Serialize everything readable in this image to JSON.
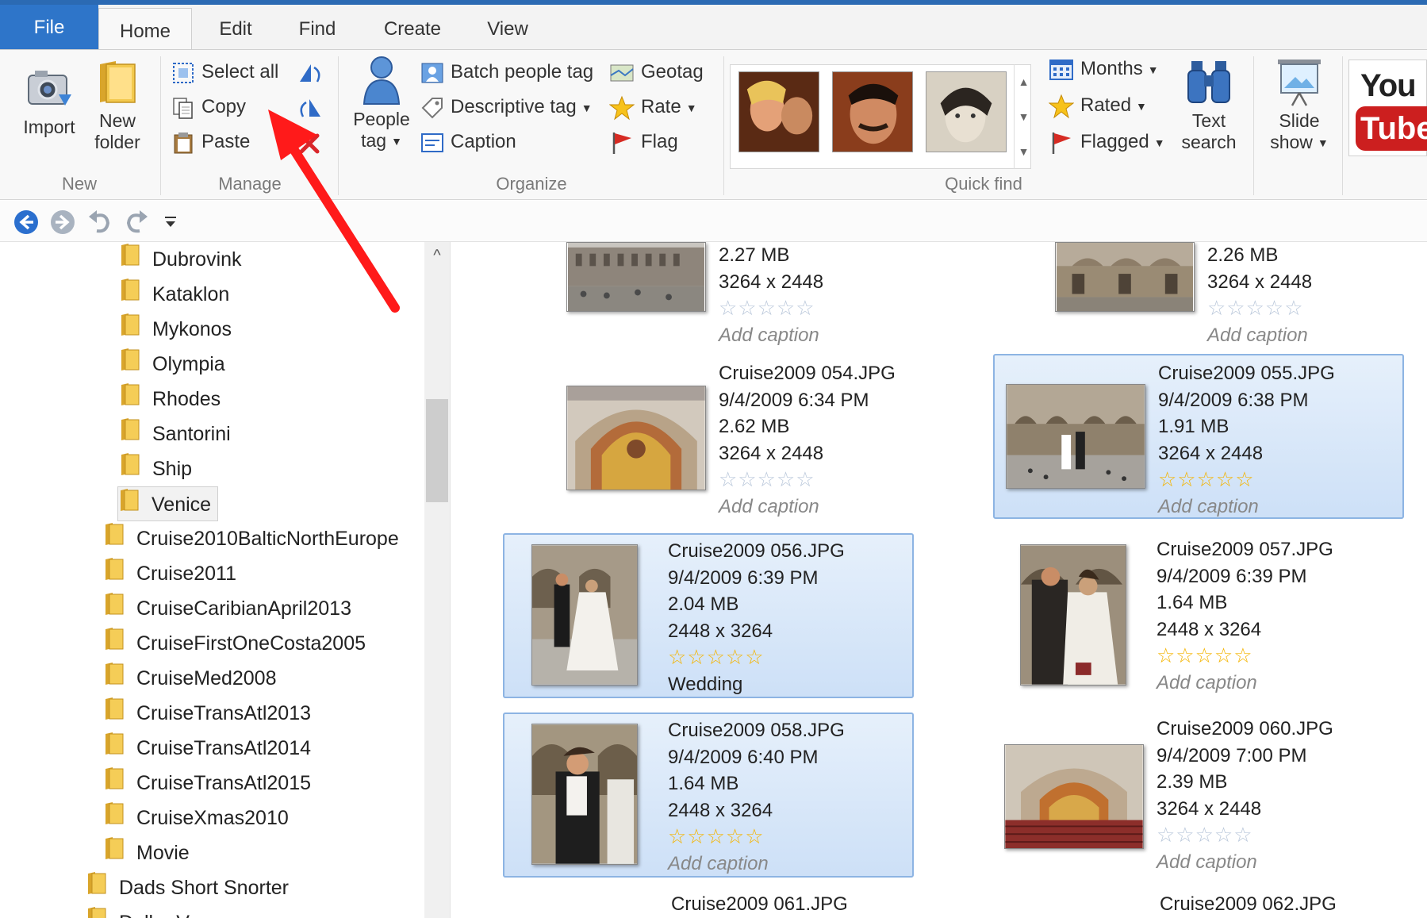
{
  "tabs": {
    "file": "File",
    "home": "Home",
    "edit": "Edit",
    "find": "Find",
    "create": "Create",
    "view": "View"
  },
  "ribbon": {
    "new_group": {
      "label": "New",
      "import": "Import",
      "new_folder_line1": "New",
      "new_folder_line2": "folder"
    },
    "manage_group": {
      "label": "Manage",
      "select_all": "Select all",
      "copy": "Copy",
      "paste": "Paste"
    },
    "organize_group": {
      "label": "Organize",
      "people_tag_line1": "People",
      "people_tag_line2": "tag",
      "batch_people_tag": "Batch people tag",
      "descriptive_tag": "Descriptive tag",
      "caption": "Caption",
      "geotag": "Geotag",
      "rate": "Rate",
      "flag": "Flag"
    },
    "quick_find_group": {
      "label": "Quick find",
      "months": "Months",
      "rated": "Rated",
      "flagged": "Flagged",
      "text_search_line1": "Text",
      "text_search_line2": "search",
      "slide_show_line1": "Slide",
      "slide_show_line2": "show"
    },
    "youtube": {
      "line1": "You",
      "line2": "Tube"
    }
  },
  "tree": {
    "items": [
      {
        "label": "Dubrovink"
      },
      {
        "label": "Kataklon"
      },
      {
        "label": "Mykonos"
      },
      {
        "label": "Olympia"
      },
      {
        "label": "Rhodes"
      },
      {
        "label": "Santorini"
      },
      {
        "label": "Ship"
      },
      {
        "label": "Venice",
        "selected": true
      },
      {
        "label": "Cruise2010BalticNorthEurope"
      },
      {
        "label": "Cruise2011"
      },
      {
        "label": "CruiseCaribianApril2013"
      },
      {
        "label": "CruiseFirstOneCosta2005"
      },
      {
        "label": "CruiseMed2008"
      },
      {
        "label": "CruiseTransAtl2013"
      },
      {
        "label": "CruiseTransAtl2014"
      },
      {
        "label": "CruiseTransAtl2015"
      },
      {
        "label": "CruiseXmas2010"
      },
      {
        "label": "Movie"
      },
      {
        "label": "Dads Short Snorter"
      },
      {
        "label": "Dollar Vaca..."
      }
    ]
  },
  "photos": [
    {
      "name": "",
      "date": "",
      "size": "2.27 MB",
      "dims": "3264 x 2448",
      "rating": 0,
      "caption": "Add caption"
    },
    {
      "name": "",
      "date": "",
      "size": "2.26 MB",
      "dims": "3264 x 2448",
      "rating": 0,
      "caption": "Add caption"
    },
    {
      "name": "Cruise2009 054.JPG",
      "date": "9/4/2009 6:34 PM",
      "size": "2.62 MB",
      "dims": "3264 x 2448",
      "rating": 0,
      "caption": "Add caption"
    },
    {
      "name": "Cruise2009 055.JPG",
      "date": "9/4/2009 6:38 PM",
      "size": "1.91 MB",
      "dims": "3264 x 2448",
      "rating": 5,
      "caption": "Add caption"
    },
    {
      "name": "Cruise2009 056.JPG",
      "date": "9/4/2009 6:39 PM",
      "size": "2.04 MB",
      "dims": "2448 x 3264",
      "rating": 5,
      "caption": "Wedding"
    },
    {
      "name": "Cruise2009 057.JPG",
      "date": "9/4/2009 6:39 PM",
      "size": "1.64 MB",
      "dims": "2448 x 3264",
      "rating": 5,
      "caption": "Add caption"
    },
    {
      "name": "Cruise2009 058.JPG",
      "date": "9/4/2009 6:40 PM",
      "size": "1.64 MB",
      "dims": "2448 x 3264",
      "rating": 5,
      "caption": "Add caption"
    },
    {
      "name": "Cruise2009 060.JPG",
      "date": "9/4/2009 7:00 PM",
      "size": "2.39 MB",
      "dims": "3264 x 2448",
      "rating": 0,
      "caption": "Add caption"
    },
    {
      "name": "Cruise2009 061.JPG"
    },
    {
      "name": "Cruise2009 062.JPG"
    }
  ],
  "colors": {
    "file_tab": "#2e75c9",
    "selection": "#cde0f7",
    "arrow": "#ff1a1a",
    "star_gold": "#f4b400"
  }
}
